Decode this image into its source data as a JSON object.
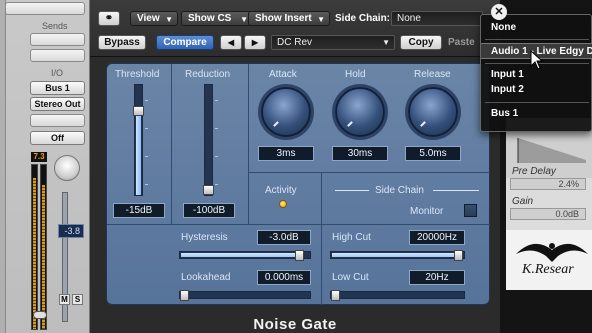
{
  "mixer": {
    "sends_label": "Sends",
    "io_label": "I/O",
    "input": "Bus 1",
    "output": "Stereo Out",
    "automation": "Off",
    "peak": "7.3",
    "volume": "-3.8",
    "mute": "M",
    "solo": "S"
  },
  "header": {
    "view_menu": "View",
    "show_cs_menu": "Show CS",
    "show_insert_menu": "Show Insert",
    "side_chain_label": "Side Chain:",
    "side_chain_value": "None",
    "bypass_button": "Bypass",
    "compare_button": "Compare",
    "prev_arrow": "◀",
    "next_arrow": "▶",
    "preset_name": "DC Rev",
    "copy_button": "Copy",
    "paste_button": "Paste"
  },
  "gate": {
    "threshold_label": "Threshold",
    "threshold_value": "-15dB",
    "reduction_label": "Reduction",
    "reduction_value": "-100dB",
    "attack_label": "Attack",
    "attack_value": "3ms",
    "hold_label": "Hold",
    "hold_value": "30ms",
    "release_label": "Release",
    "release_value": "5.0ms",
    "activity_label": "Activity",
    "side_chain_label": "Side Chain",
    "monitor_label": "Monitor",
    "hysteresis_label": "Hysteresis",
    "hysteresis_value": "-3.0dB",
    "lookahead_label": "Lookahead",
    "lookahead_value": "0.000ms",
    "high_cut_label": "High Cut",
    "high_cut_value": "20000Hz",
    "low_cut_label": "Low Cut",
    "low_cut_value": "20Hz",
    "title": "Noise Gate",
    "levels": {
      "threshold": 0.78,
      "reduction": 0.02,
      "hysteresis": 0.93,
      "lookahead": 0.02,
      "high_cut": 1.0,
      "low_cut": 0.02
    }
  },
  "right_plugin": {
    "pre_delay_label": "Pre Delay",
    "pre_delay_value": "2.4%",
    "gain_label": "Gain",
    "gain_value": "0.0dB",
    "brand": "K.Resear"
  },
  "menu": {
    "items": [
      "None",
      "Audio 1 - Live Edgy D",
      "Input 1",
      "Input 2",
      "Bus 1"
    ]
  },
  "colors": {
    "panel": "#6b85a7",
    "accent_blue": "#2f62b3",
    "led": "#f0a800"
  }
}
